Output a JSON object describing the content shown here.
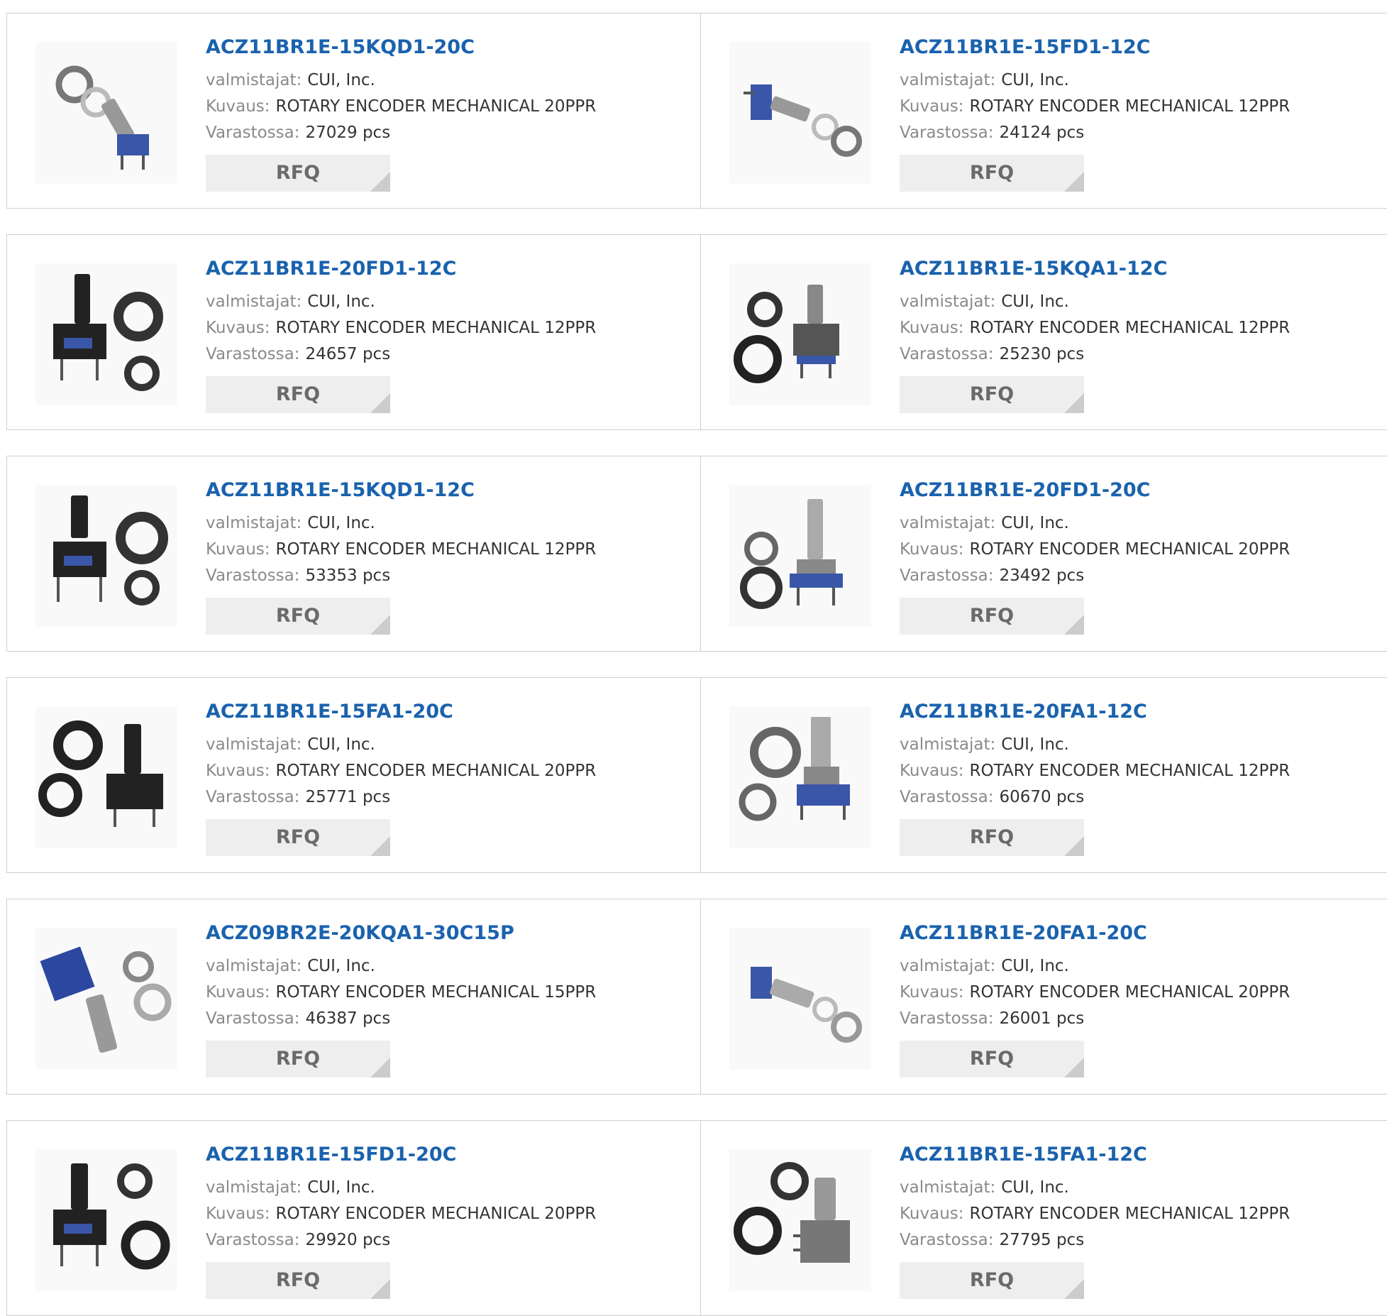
{
  "labels": {
    "manufacturer": "valmistajat:",
    "description": "Kuvaus:",
    "stock": "Varastossa:",
    "rfq": "RFQ"
  },
  "products": [
    {
      "part": "ACZ11BR1E-15KQD1-20C",
      "manufacturer": "CUI, Inc.",
      "description": "ROTARY ENCODER MECHANICAL 20PPR",
      "stock": "27029 pcs",
      "image": "rotary-encoder-photo"
    },
    {
      "part": "ACZ11BR1E-15FD1-12C",
      "manufacturer": "CUI, Inc.",
      "description": "ROTARY ENCODER MECHANICAL 12PPR",
      "stock": "24124 pcs",
      "image": "rotary-encoder-photo"
    },
    {
      "part": "ACZ11BR1E-20FD1-12C",
      "manufacturer": "CUI, Inc.",
      "description": "ROTARY ENCODER MECHANICAL 12PPR",
      "stock": "24657 pcs",
      "image": "rotary-encoder-photo"
    },
    {
      "part": "ACZ11BR1E-15KQA1-12C",
      "manufacturer": "CUI, Inc.",
      "description": "ROTARY ENCODER MECHANICAL 12PPR",
      "stock": "25230 pcs",
      "image": "rotary-encoder-photo"
    },
    {
      "part": "ACZ11BR1E-15KQD1-12C",
      "manufacturer": "CUI, Inc.",
      "description": "ROTARY ENCODER MECHANICAL 12PPR",
      "stock": "53353 pcs",
      "image": "rotary-encoder-photo"
    },
    {
      "part": "ACZ11BR1E-20FD1-20C",
      "manufacturer": "CUI, Inc.",
      "description": "ROTARY ENCODER MECHANICAL 20PPR",
      "stock": "23492 pcs",
      "image": "rotary-encoder-photo"
    },
    {
      "part": "ACZ11BR1E-15FA1-20C",
      "manufacturer": "CUI, Inc.",
      "description": "ROTARY ENCODER MECHANICAL 20PPR",
      "stock": "25771 pcs",
      "image": "rotary-encoder-photo"
    },
    {
      "part": "ACZ11BR1E-20FA1-12C",
      "manufacturer": "CUI, Inc.",
      "description": "ROTARY ENCODER MECHANICAL 12PPR",
      "stock": "60670 pcs",
      "image": "rotary-encoder-photo"
    },
    {
      "part": "ACZ09BR2E-20KQA1-30C15P",
      "manufacturer": "CUI, Inc.",
      "description": "ROTARY ENCODER MECHANICAL 15PPR",
      "stock": "46387 pcs",
      "image": "rotary-encoder-photo"
    },
    {
      "part": "ACZ11BR1E-20FA1-20C",
      "manufacturer": "CUI, Inc.",
      "description": "ROTARY ENCODER MECHANICAL 20PPR",
      "stock": "26001 pcs",
      "image": "rotary-encoder-photo"
    },
    {
      "part": "ACZ11BR1E-15FD1-20C",
      "manufacturer": "CUI, Inc.",
      "description": "ROTARY ENCODER MECHANICAL 20PPR",
      "stock": "29920 pcs",
      "image": "rotary-encoder-photo"
    },
    {
      "part": "ACZ11BR1E-15FA1-12C",
      "manufacturer": "CUI, Inc.",
      "description": "ROTARY ENCODER MECHANICAL 12PPR",
      "stock": "27795 pcs",
      "image": "rotary-encoder-photo"
    }
  ],
  "colors": {
    "link": "#1a62ad",
    "label": "#8a8a8a",
    "value": "#333333",
    "button_bg": "#eeeeee",
    "button_text": "#6a6a6a",
    "border": "#cfcfcf"
  }
}
